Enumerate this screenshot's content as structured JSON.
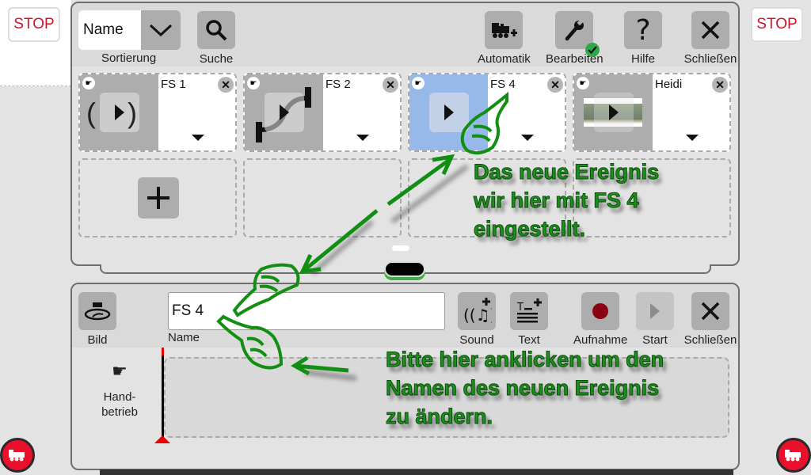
{
  "stop_left": "STOP",
  "stop_right": "STOP",
  "library": {
    "sort_value": "Name",
    "sort_label": "Sortierung",
    "search_label": "Suche",
    "automatic_label": "Automatik",
    "edit_label": "Bearbeiten",
    "help_label": "Hilfe",
    "close_label": "Schließen",
    "events": [
      {
        "name": "FS 1",
        "icon": "sound-icon",
        "selected": false
      },
      {
        "name": "FS 2",
        "icon": "route-icon",
        "selected": false
      },
      {
        "name": "FS 4",
        "icon": "play-icon",
        "selected": true
      },
      {
        "name": "Heidi",
        "icon": "locomotive-photo",
        "selected": false
      }
    ],
    "add_label": "+"
  },
  "editor": {
    "image_label": "Bild",
    "name_value": "FS 4",
    "name_label": "Name",
    "sound_label": "Sound",
    "text_label": "Text",
    "record_label": "Aufnahme",
    "start_label": "Start",
    "close_label": "Schließen",
    "manual_label_1": "Hand-",
    "manual_label_2": "betrieb"
  },
  "annotations": {
    "note1": [
      "Das neue Ereignis",
      "wir hier mit FS 4",
      "eingestellt."
    ],
    "note2": [
      "Bitte hier anklicken um den",
      "Namen des neuen Ereignis",
      "zu ändern."
    ]
  },
  "colors": {
    "stop_red": "#d8102a",
    "annotation_green": "#1e8f1e",
    "selected_blue": "#97b9ea",
    "record_red": "#8b0010"
  }
}
